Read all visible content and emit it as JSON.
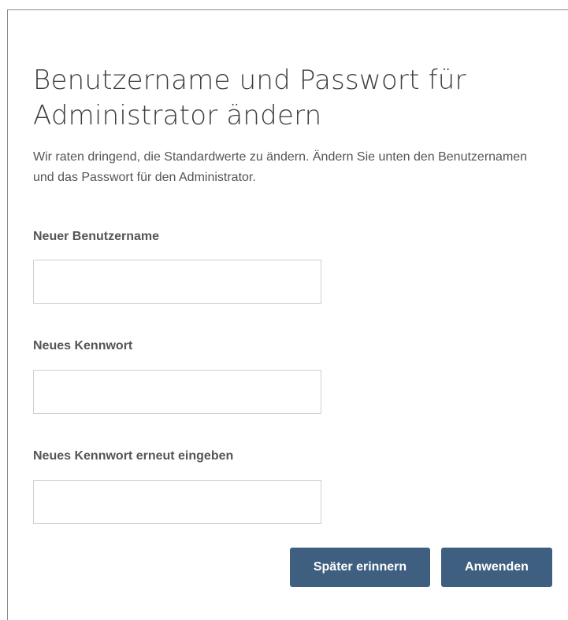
{
  "dialog": {
    "title": "Benutzername und Passwort für Administrator ändern",
    "description": "Wir raten dringend, die Standardwerte zu ändern. Ändern Sie unten den Benutzernamen und das Passwort für den Administrator."
  },
  "fields": {
    "username": {
      "label": "Neuer Benutzername",
      "value": "",
      "placeholder": ""
    },
    "password": {
      "label": "Neues Kennwort",
      "value": "",
      "placeholder": ""
    },
    "password_confirm": {
      "label": "Neues Kennwort erneut eingeben",
      "value": "",
      "placeholder": ""
    }
  },
  "buttons": {
    "remind_later": "Später erinnern",
    "apply": "Anwenden"
  },
  "colors": {
    "button_bg": "#3e5f80",
    "button_text": "#ffffff",
    "input_border": "#cfcfcf"
  }
}
